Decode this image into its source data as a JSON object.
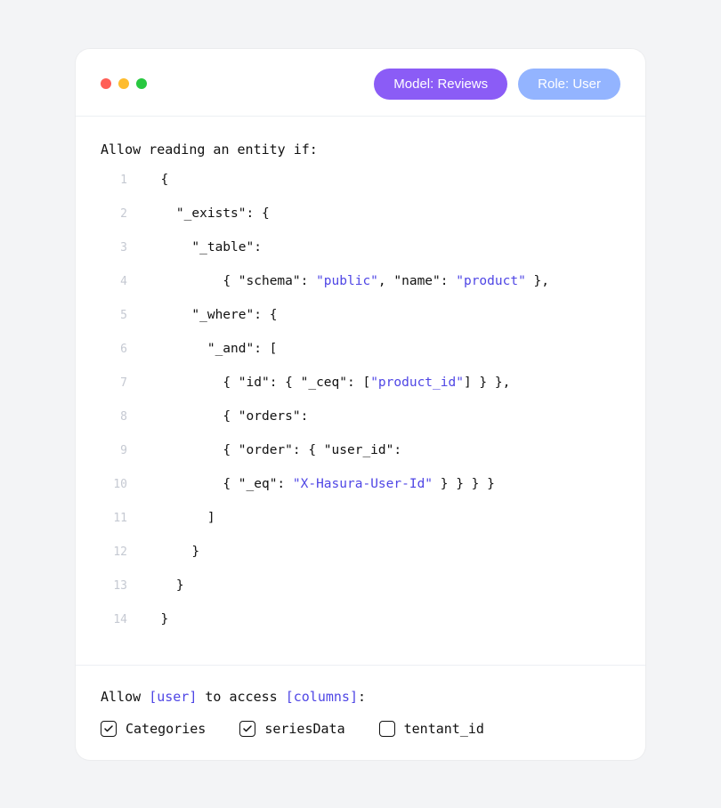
{
  "pills": {
    "model": "Model: Reviews",
    "role": "Role: User"
  },
  "heading": "Allow reading an entity if:",
  "code": {
    "lines": [
      {
        "n": "1",
        "indent": "  ",
        "segs": [
          {
            "t": "{"
          }
        ]
      },
      {
        "n": "2",
        "indent": "    ",
        "segs": [
          {
            "t": "\"_exists\": {"
          }
        ]
      },
      {
        "n": "3",
        "indent": "      ",
        "segs": [
          {
            "t": "\"_table\":"
          }
        ]
      },
      {
        "n": "4",
        "indent": "          ",
        "segs": [
          {
            "t": "{ \"schema\": "
          },
          {
            "t": "\"public\"",
            "c": "str"
          },
          {
            "t": ", \"name\": "
          },
          {
            "t": "\"product\"",
            "c": "str"
          },
          {
            "t": " },"
          }
        ]
      },
      {
        "n": "5",
        "indent": "      ",
        "segs": [
          {
            "t": "\"_where\": {"
          }
        ]
      },
      {
        "n": "6",
        "indent": "        ",
        "segs": [
          {
            "t": "\"_and\": ["
          }
        ]
      },
      {
        "n": "7",
        "indent": "          ",
        "segs": [
          {
            "t": "{ \"id\": { \"_ceq\": ["
          },
          {
            "t": "\"product_id\"",
            "c": "str"
          },
          {
            "t": "] } },"
          }
        ]
      },
      {
        "n": "8",
        "indent": "          ",
        "segs": [
          {
            "t": "{ \"orders\":"
          }
        ]
      },
      {
        "n": "9",
        "indent": "          ",
        "segs": [
          {
            "t": "{ \"order\": { \"user_id\":"
          }
        ]
      },
      {
        "n": "10",
        "indent": "          ",
        "segs": [
          {
            "t": "{ \"_eq\": "
          },
          {
            "t": "\"X-Hasura-User-Id\"",
            "c": "str"
          },
          {
            "t": " } } } }"
          }
        ]
      },
      {
        "n": "11",
        "indent": "        ",
        "segs": [
          {
            "t": "]"
          }
        ]
      },
      {
        "n": "12",
        "indent": "      ",
        "segs": [
          {
            "t": "}"
          }
        ]
      },
      {
        "n": "13",
        "indent": "    ",
        "segs": [
          {
            "t": "}"
          }
        ]
      },
      {
        "n": "14",
        "indent": "  ",
        "segs": [
          {
            "t": "}"
          }
        ]
      }
    ]
  },
  "footer": {
    "heading_parts": {
      "pre": "Allow ",
      "user": "[user]",
      "mid": " to access ",
      "columns": "[columns]",
      "post": ":"
    },
    "checkboxes": [
      {
        "label": "Categories",
        "checked": true
      },
      {
        "label": "seriesData",
        "checked": true
      },
      {
        "label": "tentant_id",
        "checked": false
      }
    ]
  }
}
